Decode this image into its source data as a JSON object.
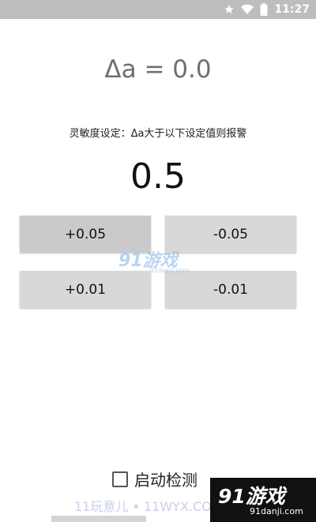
{
  "status_bar": {
    "time": "11:27",
    "icons": [
      "star-icon",
      "wifi-icon",
      "battery-icon"
    ],
    "background": "#bdbdbd"
  },
  "readout": {
    "delta": "Δa = 0.0"
  },
  "sensitivity": {
    "label": "灵敏度设定：Δa大于以下设定值则报警",
    "value": "0.5"
  },
  "buttons": {
    "plus_005": "+0.05",
    "minus_005": "-0.05",
    "plus_001": "+0.01",
    "minus_001": "-0.01"
  },
  "detection": {
    "label": "启动检测",
    "checked": false
  },
  "watermarks": {
    "center_main": "91游戏",
    "center_sub": "91danji.com",
    "bottom_text": "11玩意儿 • 11WYX.COM",
    "corner_main": "91游戏",
    "corner_sub": "91danji.com"
  }
}
